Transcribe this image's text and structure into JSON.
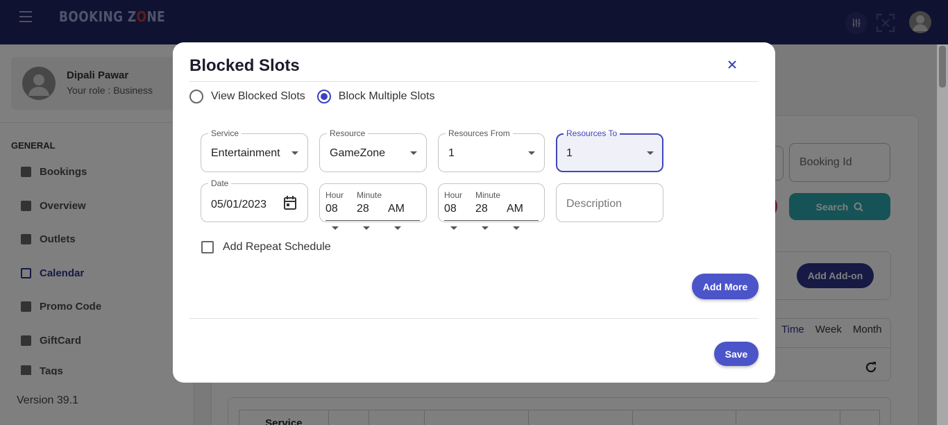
{
  "app": {
    "logo_text_pre": "BOOKING Z",
    "logo_text_o": "O",
    "logo_text_post": "NE"
  },
  "sidebar": {
    "user_name": "Dipali Pawar",
    "user_role": "Your role : Business",
    "group_label": "GENERAL",
    "items": [
      {
        "label": "Bookings",
        "icon": "bookings-icon"
      },
      {
        "label": "Overview",
        "icon": "chart-icon"
      },
      {
        "label": "Outlets",
        "icon": "store-icon"
      },
      {
        "label": "Calendar",
        "icon": "calendar-icon",
        "active": true
      },
      {
        "label": "Promo Code",
        "icon": "gift-icon"
      },
      {
        "label": "GiftCard",
        "icon": "giftcard-icon"
      },
      {
        "label": "Tags",
        "icon": "tag-icon"
      }
    ],
    "version": "Version 39.1"
  },
  "background": {
    "booking_id_placeholder": "Booking Id",
    "search_label": "Search",
    "add_addon_label": "Add Add-on",
    "view_tabs": [
      "Time",
      "Week",
      "Month"
    ],
    "table_header_first": "Service"
  },
  "modal": {
    "title": "Blocked Slots",
    "radio_options": [
      {
        "label": "View Blocked Slots",
        "selected": false
      },
      {
        "label": "Block Multiple Slots",
        "selected": true
      }
    ],
    "service": {
      "label": "Service",
      "value": "Entertainment"
    },
    "resource": {
      "label": "Resource",
      "value": "GameZone"
    },
    "resources_from": {
      "label": "Resources From",
      "value": "1"
    },
    "resources_to": {
      "label": "Resources To",
      "value": "1"
    },
    "date": {
      "label": "Date",
      "value": "05/01/2023"
    },
    "start_time": {
      "hour_label": "Hour",
      "minute_label": "Minute",
      "hour": "08",
      "minute": "28",
      "period": "AM"
    },
    "end_time": {
      "hour_label": "Hour",
      "minute_label": "Minute",
      "hour": "08",
      "minute": "28",
      "period": "AM"
    },
    "description_placeholder": "Description",
    "repeat_label": "Add Repeat Schedule",
    "add_more_label": "Add More",
    "save_label": "Save"
  },
  "colors": {
    "header_bg": "#1f2560",
    "accent": "#4c54c9",
    "search_button": "#2aa7ad",
    "addon_button": "#2c348a"
  }
}
